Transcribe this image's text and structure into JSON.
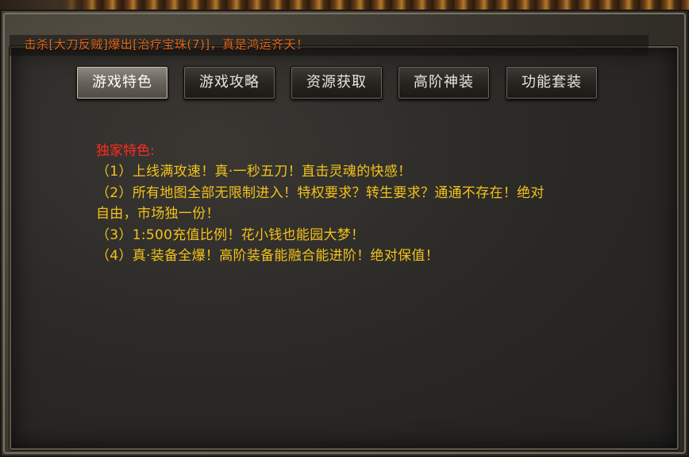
{
  "notice": {
    "lead_fragment": "击",
    "text": "杀[大刀反贼]爆出[治疗宝珠(7)]，真是鸿运齐天！"
  },
  "tabs": [
    {
      "label": "游戏特色",
      "active": true
    },
    {
      "label": "游戏攻略",
      "active": false
    },
    {
      "label": "资源获取",
      "active": false
    },
    {
      "label": "高阶神装",
      "active": false
    },
    {
      "label": "功能套装",
      "active": false
    }
  ],
  "content": {
    "heading": "独家特色:",
    "lines": [
      "（1）上线满攻速！真·一秒五刀！直击灵魂的快感！",
      "（2）所有地图全部无限制进入！特权要求？转生要求？通通不存在！绝对",
      "自由，市场独一份！",
      "（3）1:500充值比例！花小钱也能园大梦！",
      "（4）真·装备全爆！高阶装备能融合能进阶！绝对保值！"
    ]
  },
  "colors": {
    "heading": "#ff2a1e",
    "body_text": "#f2c21a",
    "notice_text": "#e06a20"
  }
}
